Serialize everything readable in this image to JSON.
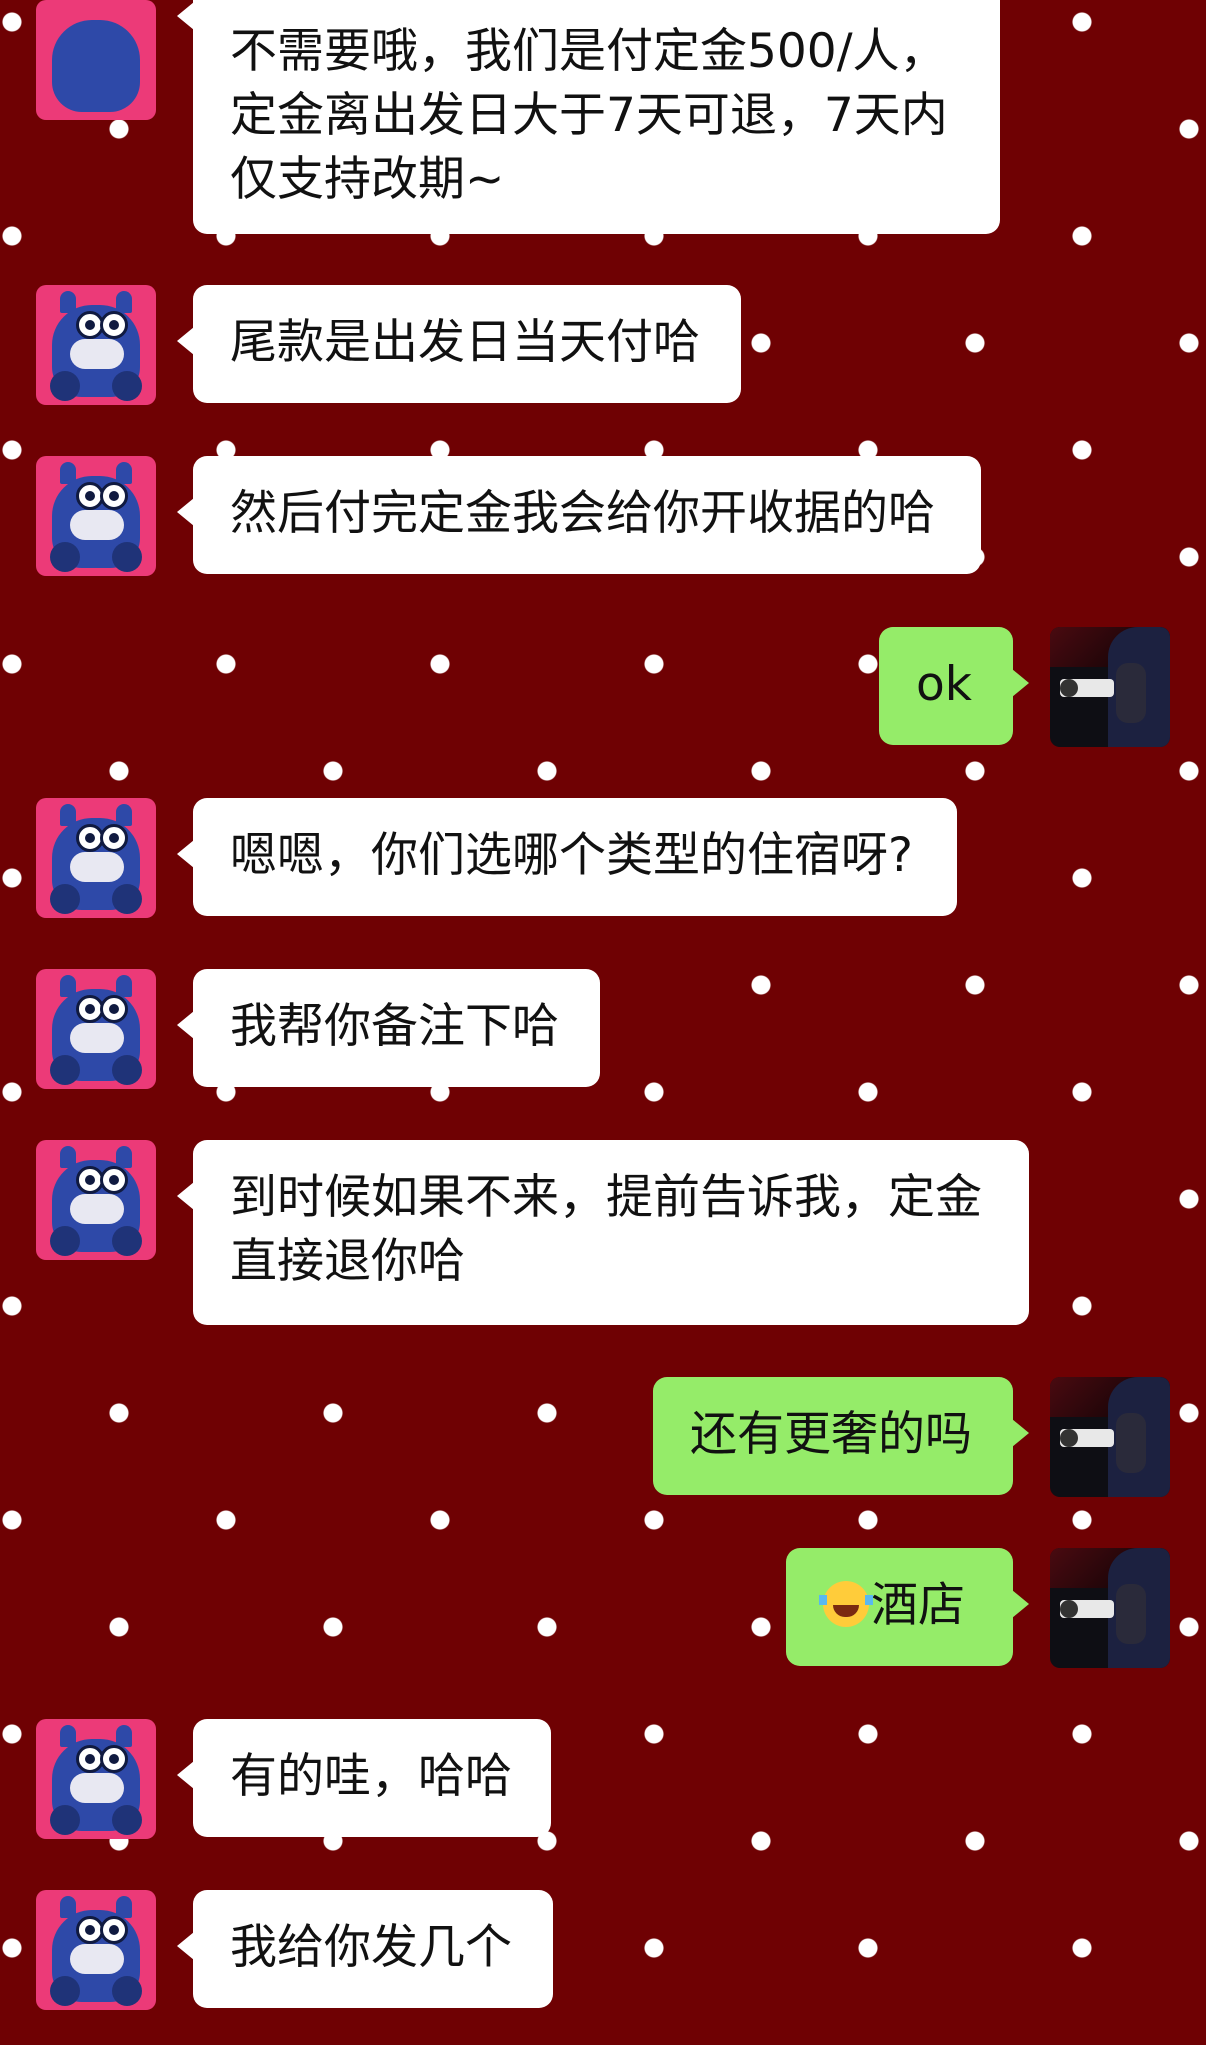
{
  "conversation": {
    "messages": [
      {
        "side": "in",
        "text": "不需要哦，我们是付定金500/人，定金离出发日大于7天可退，7天内仅支持改期~"
      },
      {
        "side": "in",
        "text": "尾款是出发日当天付哈"
      },
      {
        "side": "in",
        "text": "然后付完定金我会给你开收据的哈"
      },
      {
        "side": "out",
        "text": "ok"
      },
      {
        "side": "in",
        "text": "嗯嗯，你们选哪个类型的住宿呀?"
      },
      {
        "side": "in",
        "text": "我帮你备注下哈"
      },
      {
        "side": "in",
        "text": "到时候如果不来，提前告诉我，定金直接退你哈"
      },
      {
        "side": "out",
        "text": "还有更奢的吗"
      },
      {
        "side": "out",
        "emoji": "grinning-tears-emoji",
        "text": "酒店"
      },
      {
        "side": "in",
        "text": "有的哇，哈哈"
      },
      {
        "side": "in",
        "text": "我给你发几个"
      }
    ]
  },
  "colors": {
    "background": "#6f0103",
    "dots": "#ffffff",
    "incoming_bubble": "#ffffff",
    "outgoing_bubble": "#95ec69"
  },
  "avatars": {
    "incoming": "cow-cartoon-avatar",
    "outgoing": "hooded-person-photo-avatar"
  }
}
